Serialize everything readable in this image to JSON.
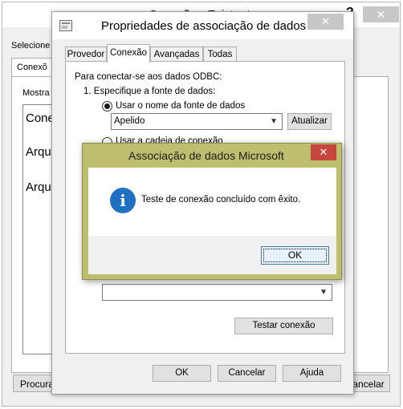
{
  "background_dialog": {
    "title": "Conexão - Existente",
    "help": "?",
    "close": "✕",
    "select_label": "Selecione",
    "tab_label": "Conexõ",
    "show_label": "Mostra",
    "list_items": [
      "Cone",
      "Arqu",
      "Arqu"
    ],
    "browse_button": "Procura",
    "cancel_button": "ancelar"
  },
  "properties_dialog": {
    "title": "Propriedades de associação de dados",
    "close": "✕",
    "tabs": [
      "Provedor",
      "Conexão",
      "Avançadas",
      "Todas"
    ],
    "active_tab": "Conexão",
    "intro": "Para conectar-se aos dados ODBC:",
    "step1": "1. Especifique a fonte de dados:",
    "radio_dsn_label": "Usar o nome da fonte de dados",
    "dsn_value": "Apelido",
    "refresh_button": "Atualizar",
    "radio_conn_string_label": "Usar a cadeia de conexão",
    "bottom_combo_value": "",
    "test_connection_button": "Testar conexão",
    "ok_button": "OK",
    "cancel_button": "Cancelar",
    "help_button": "Ajuda"
  },
  "message_box": {
    "title": "Associação de dados Microsoft",
    "close": "✕",
    "icon": "information-icon",
    "icon_glyph": "i",
    "message": "Teste de conexão concluído com êxito.",
    "ok_button": "OK",
    "accent_color": "#bebe6f",
    "icon_color": "#1f6fc2"
  }
}
